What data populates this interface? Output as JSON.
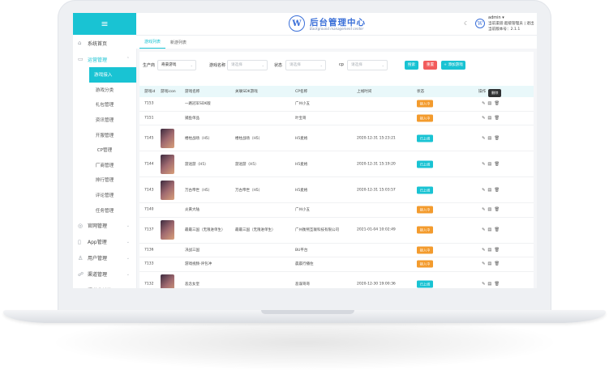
{
  "sidebar": {
    "menu_icon": "≡",
    "items": [
      {
        "label": "系统首页",
        "icon": "home-icon",
        "glyph": "⌂"
      },
      {
        "label": "运营管理",
        "icon": "monitor-icon",
        "glyph": "▭",
        "expanded": true
      }
    ],
    "subitems": [
      "游戏接入",
      "游戏分类",
      "礼包管理",
      "资讯管理",
      "开服管理",
      "CP管理",
      "厂商管理",
      "排行管理",
      "评论管理",
      "任务管理"
    ],
    "active_sub": "游戏接入",
    "items_bottom": [
      {
        "label": "官网管理",
        "glyph": "◎"
      },
      {
        "label": "App管理",
        "glyph": "▯"
      },
      {
        "label": "用户管理",
        "glyph": "♙"
      },
      {
        "label": "渠道管理",
        "glyph": "☍"
      },
      {
        "label": "渠道收益管理",
        "glyph": "◉"
      }
    ]
  },
  "header": {
    "logo_letter": "W",
    "brand_cn": "后台管理中心",
    "brand_en": "Background management center",
    "username": "admin ▾",
    "role": "当前渠道:超级管理员 | 退出",
    "version": "当前版本号：2.1.1"
  },
  "tabs": [
    {
      "label": "游戏列表",
      "active": true
    },
    {
      "label": "新游列表",
      "active": false
    }
  ],
  "filter": {
    "label_vendor": "生产商",
    "vendor_value": "奇豪游戏",
    "label_name": "游戏名称",
    "name_placeholder": "请选择",
    "label_status": "状态",
    "status_placeholder": "请选择",
    "label_cp": "cp",
    "cp_placeholder": "请选择",
    "btn_search": "搜索",
    "btn_reset": "重置",
    "btn_add": "+ 添加游戏"
  },
  "table": {
    "columns": [
      "游戏id",
      "游戏icon",
      "游戏名称",
      "关联SDK游戏",
      "CP名称",
      "上线时间",
      "状态",
      "操作"
    ],
    "tooltip": "删除",
    "rows": [
      {
        "id": "7153",
        "icon": false,
        "name": "一路冠军SDK版",
        "sdk": "",
        "cp": "广州小五",
        "time": "",
        "status": "接入中",
        "status_color": "orange"
      },
      {
        "id": "7151",
        "icon": false,
        "name": "捕鱼单品",
        "sdk": "",
        "cp": "叶宝哥",
        "time": "",
        "status": "接入中",
        "status_color": "orange"
      },
      {
        "id": "7145",
        "icon": true,
        "name": "楼柱战场（H5）",
        "sdk": "楼柱战场（H5）",
        "cp": "H5麦格",
        "time": "2020-12-31 15:23:21",
        "status": "已上线",
        "status_color": "cyan"
      },
      {
        "id": "7144",
        "icon": true,
        "name": "游逍游（H5）",
        "sdk": "游逍游（H5）",
        "cp": "H5麦格",
        "time": "2020-12-31 15:19:20",
        "status": "已上线",
        "status_color": "cyan"
      },
      {
        "id": "7143",
        "icon": true,
        "name": "万古帝世（H5）",
        "sdk": "万古帝世（H5）",
        "cp": "H5麦格",
        "time": "2020-12-31 15:03:57",
        "status": "已上线",
        "status_color": "cyan"
      },
      {
        "id": "7140",
        "icon": false,
        "name": "炎黄大陆",
        "sdk": "",
        "cp": "广州小五",
        "time": "",
        "status": "接入中",
        "status_color": "orange"
      },
      {
        "id": "7137",
        "icon": true,
        "name": "最最三国（无限进单生）",
        "sdk": "最最三国（无限进单生）",
        "cp": "广州衡熙互联科技有限公司",
        "time": "2021-01-04 10:02:49",
        "status": "接入中",
        "status_color": "orange"
      },
      {
        "id": "7136",
        "icon": false,
        "name": "决战三国",
        "sdk": "",
        "cp": "BU平台",
        "time": "",
        "status": "接入中",
        "status_color": "orange"
      },
      {
        "id": "7133",
        "icon": false,
        "name": "游戏视频-评包冲",
        "sdk": "",
        "cp": "晨晨行播住",
        "time": "",
        "status": "接入中",
        "status_color": "orange"
      },
      {
        "id": "7132",
        "icon": true,
        "name": "恶念女皇",
        "sdk": "",
        "cp": "恶谋哥哥",
        "time": "2020-12-30 19:00:36",
        "status": "已上线",
        "status_color": "cyan"
      }
    ]
  }
}
